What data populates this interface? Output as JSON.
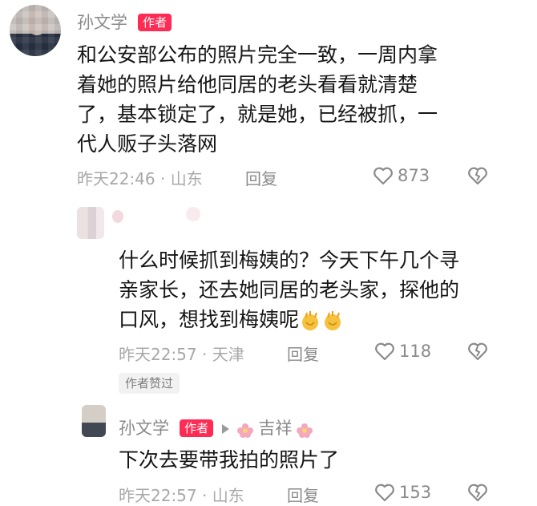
{
  "comment1": {
    "username": "孙文学",
    "badge": "作者",
    "lines": [
      "和公安部公布的照片完全一致，一周内拿",
      "着她的照片给他同居的老头看看就清楚",
      "了，基本锁定了，就是她，已经被抓，一",
      "代人贩子头落网"
    ],
    "meta": "昨天22:46 · 山东",
    "reply": "回复",
    "likes": "873"
  },
  "comment2": {
    "lines": [
      "什么时候抓到梅姨的？今天下午几个寻",
      "亲家长，还去她同居的老头家，探他的",
      "口风，想找到梅姨呢"
    ],
    "meta": "昨天22:57 · 天津",
    "reply": "回复",
    "likes": "118",
    "author_liked": "作者赞过"
  },
  "comment3": {
    "username": "孙文学",
    "badge": "作者",
    "reply_to": "吉祥",
    "text": "下次去要带我拍的照片了",
    "meta": "昨天22:57 · 山东",
    "reply": "回复",
    "likes": "153"
  },
  "colors": {
    "badge": "#fe2c55",
    "meta": "#a8a8a8",
    "text": "#161616"
  },
  "icons": [
    "heart-icon",
    "dislike-icon",
    "clap-emoji",
    "flower-emoji",
    "play-arrow-icon"
  ]
}
